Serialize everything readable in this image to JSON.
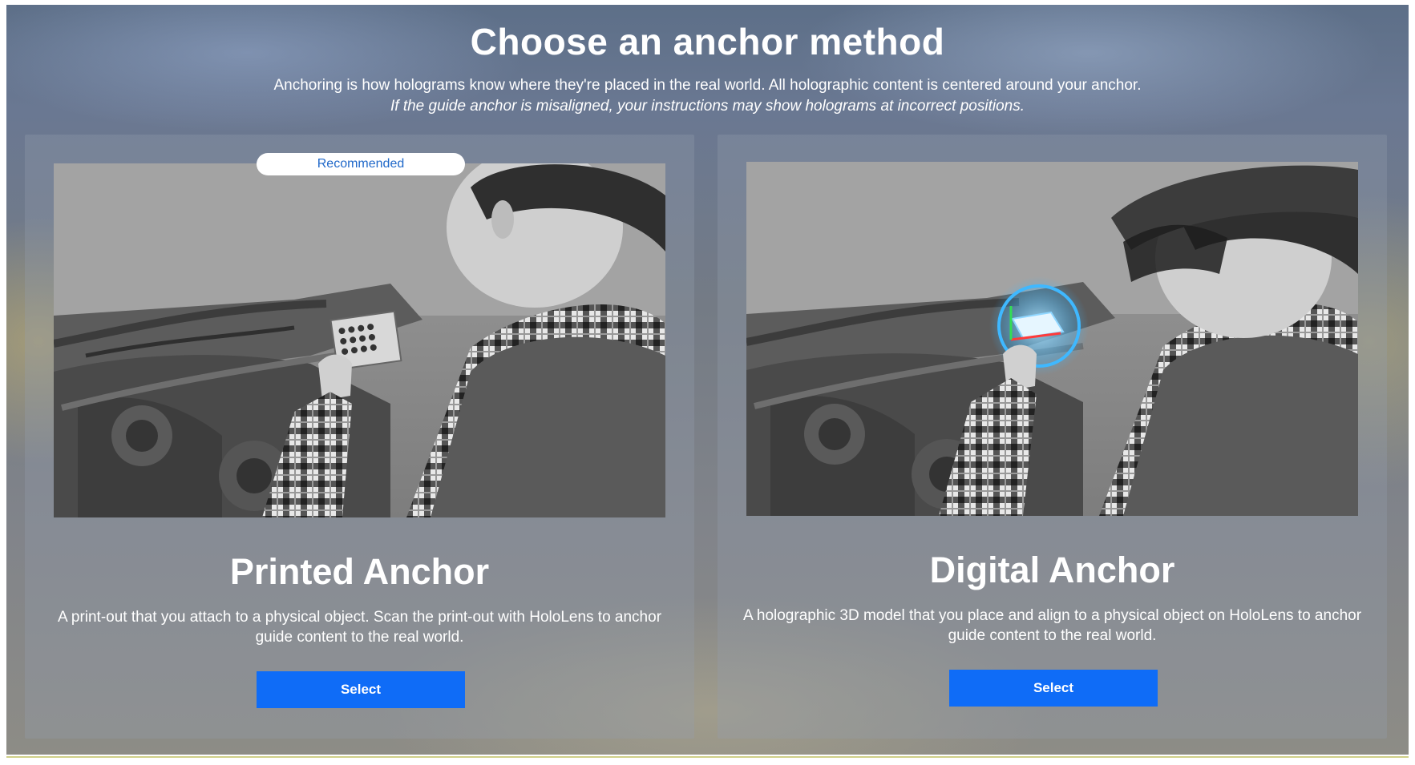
{
  "page": {
    "title": "Choose an anchor method",
    "subtitle": "Anchoring is how holograms know where they're placed in the real world. All holographic content is centered around your anchor.",
    "subtitle_italic": "If the guide anchor is misaligned, your instructions may show holograms at incorrect positions."
  },
  "cards": [
    {
      "badge": "Recommended",
      "title": "Printed Anchor",
      "description": "A print-out that you attach to a physical object. Scan the print-out with HoloLens to anchor guide content to the real world.",
      "button_label": "Select",
      "image_icon": "printed-anchor-illustration"
    },
    {
      "title": "Digital Anchor",
      "description": "A holographic 3D model that you place and align to a physical object on HoloLens to anchor guide content to the real world.",
      "button_label": "Select",
      "image_icon": "digital-anchor-illustration"
    }
  ],
  "colors": {
    "accent": "#0f6cf7",
    "badge_text": "#1f68c9",
    "hologram": "#3fb8ff"
  }
}
